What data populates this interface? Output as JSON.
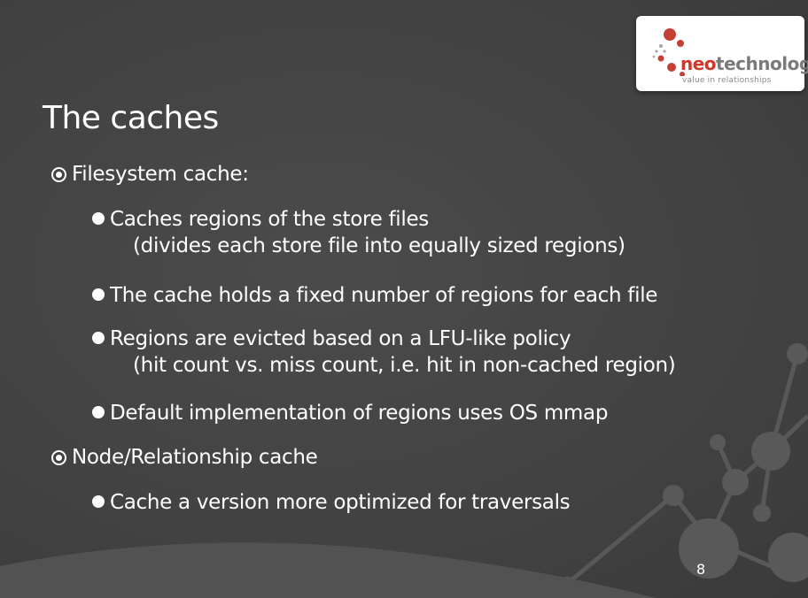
{
  "slide": {
    "title": "The caches",
    "page_number": "8"
  },
  "logo": {
    "word_neo": "neo",
    "word_technology": "technology",
    "tagline": "value in relationships",
    "accent_color": "#d1362a",
    "text_color": "#7a7a7a"
  },
  "content": {
    "l1_filesystem": "Filesystem cache:",
    "fs_items": [
      {
        "text": "Caches regions of the store files",
        "sub": "(divides each store file into equally sized regions)"
      },
      {
        "text": "The cache holds a fixed number of regions for each file",
        "sub": ""
      },
      {
        "text": "Regions are evicted based on a LFU-like policy",
        "sub": "(hit count vs. miss count, i.e. hit in non-cached region)"
      },
      {
        "text": "Default implementation of regions uses OS mmap",
        "sub": ""
      }
    ],
    "l1_node": "Node/Relationship cache",
    "node_items": [
      {
        "text": "Cache a version more optimized for traversals"
      }
    ]
  },
  "colors": {
    "background": "#434343",
    "text": "#ffffff",
    "decoration": "#5a5a5a"
  }
}
